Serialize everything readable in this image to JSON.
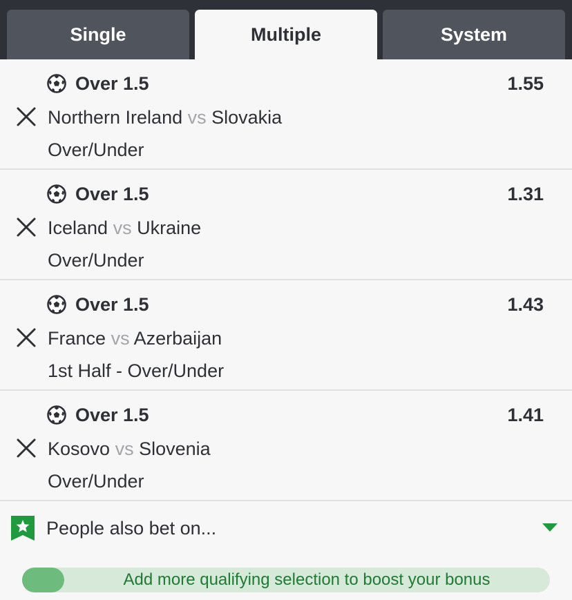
{
  "tabs": [
    {
      "label": "Single",
      "active": false
    },
    {
      "label": "Multiple",
      "active": true
    },
    {
      "label": "System",
      "active": false
    }
  ],
  "bets": [
    {
      "selection": "Over 1.5",
      "odds": "1.55",
      "home": "Northern Ireland",
      "vs": "vs",
      "away": "Slovakia",
      "market": "Over/Under",
      "sport_icon": "soccer-ball-icon",
      "remove_icon": "close-icon"
    },
    {
      "selection": "Over 1.5",
      "odds": "1.31",
      "home": "Iceland",
      "vs": "vs",
      "away": "Ukraine",
      "market": "Over/Under",
      "sport_icon": "soccer-ball-icon",
      "remove_icon": "close-icon"
    },
    {
      "selection": "Over 1.5",
      "odds": "1.43",
      "home": "France",
      "vs": "vs",
      "away": "Azerbaijan",
      "market": "1st Half - Over/Under",
      "sport_icon": "soccer-ball-icon",
      "remove_icon": "close-icon"
    },
    {
      "selection": "Over 1.5",
      "odds": "1.41",
      "home": "Kosovo",
      "vs": "vs",
      "away": "Slovenia",
      "market": "Over/Under",
      "sport_icon": "soccer-ball-icon",
      "remove_icon": "close-icon"
    }
  ],
  "people_also_bet": {
    "label": "People also bet on...",
    "icon": "star-bookmark-icon",
    "toggle_icon": "caret-down-icon"
  },
  "bonus_bar": {
    "text": "Add more qualifying selection to boost your bonus",
    "progress": 0.08
  },
  "colors": {
    "header_bg": "#2e3138",
    "tab_inactive": "#50545d",
    "accent_green": "#1f9a3e",
    "progress_fill": "#6dbb7d",
    "progress_track": "#d7ead9"
  }
}
